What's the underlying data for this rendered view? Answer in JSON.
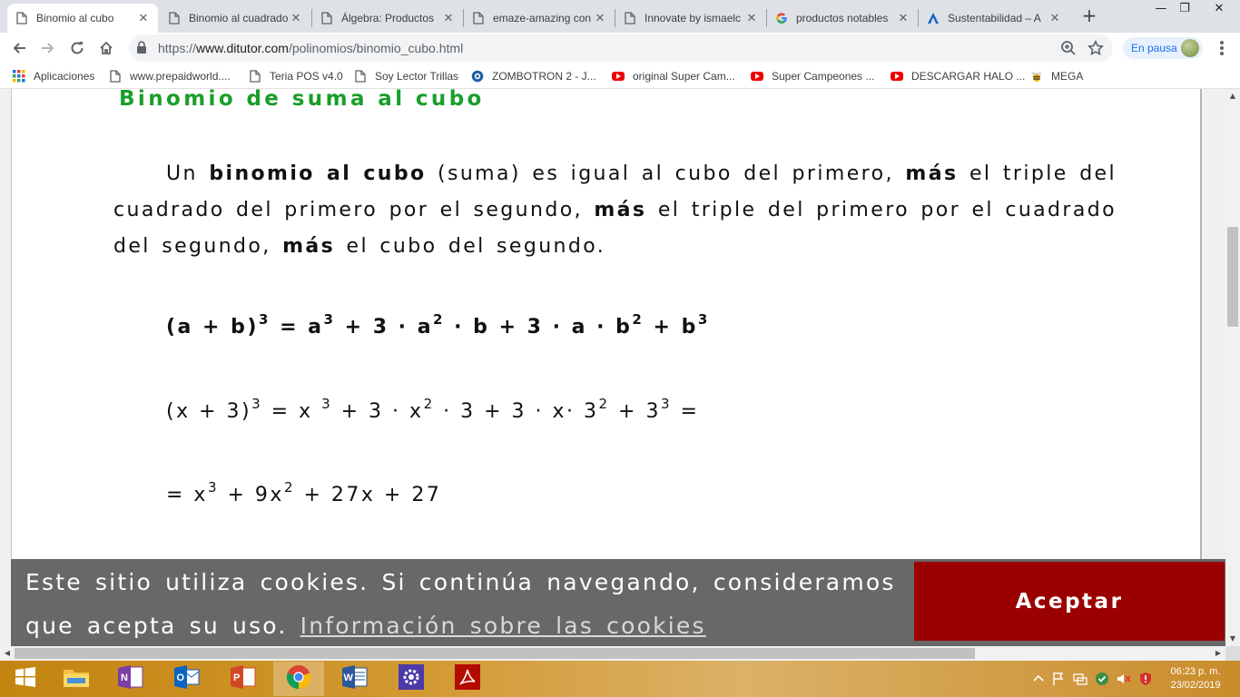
{
  "browser": {
    "tabs": [
      {
        "title": "Binomio al cubo",
        "icon": "page-icon",
        "active": true
      },
      {
        "title": "Binomio al cuadrado",
        "icon": "page-icon",
        "active": false
      },
      {
        "title": "Álgebra: Productos",
        "icon": "page-icon",
        "active": false
      },
      {
        "title": "emaze-amazing con",
        "icon": "page-icon",
        "active": false
      },
      {
        "title": "Innovate by ismaelc",
        "icon": "page-icon",
        "active": false
      },
      {
        "title": "productos notables",
        "icon": "google-icon",
        "active": false
      },
      {
        "title": "Sustentabilidad – A",
        "icon": "a-logo-icon",
        "active": false
      }
    ],
    "new_tab_symbol": "+",
    "url": {
      "prefix": "https://",
      "host": "www.ditutor.com",
      "path": "/polinomios/binomio_cubo.html"
    },
    "profile_label": "En pausa",
    "bookmarks": [
      {
        "label": "Aplicaciones",
        "icon": "apps-grid-icon"
      },
      {
        "label": "www.prepaidworld....",
        "icon": "page-icon"
      },
      {
        "label": "Teria POS v4.0",
        "icon": "page-icon"
      },
      {
        "label": "Soy Lector Trillas",
        "icon": "page-icon"
      },
      {
        "label": "ZOMBOTRON 2 - J...",
        "icon": "globe-icon"
      },
      {
        "label": "original Super Cam...",
        "icon": "youtube-icon"
      },
      {
        "label": "Super Campeones ...",
        "icon": "youtube-icon"
      },
      {
        "label": "DESCARGAR HALO ...",
        "icon": "youtube-icon"
      },
      {
        "label": "MEGA",
        "icon": "bee-icon"
      }
    ]
  },
  "page": {
    "heading": "Binomio de suma al cubo",
    "paragraph": {
      "t1": "Un ",
      "b1": "binomio al cubo",
      "t2": " (suma) es igual al cubo del primero, ",
      "b2": "más",
      "t3": " el triple del cuadrado del primero por el segundo, ",
      "b3": "más",
      "t4": " el triple del primero por el cuadrado del segundo, ",
      "b4": "más",
      "t5": " el cubo del segundo."
    },
    "formula_general": {
      "p1": "(a + b)",
      "e1": "3",
      "p2": " = a",
      "e2": "3",
      "p3": " + 3 · a",
      "e3": "2",
      "p4": " · b + 3 · a · b",
      "e4": "2",
      "p5": " + b",
      "e5": "3"
    },
    "example_line1": {
      "p1": "(x + 3)",
      "e1": "3",
      "p2": " = x ",
      "e2": "3",
      "p3": " + 3 · x",
      "e3": "2",
      "p4": " · 3 + 3 · x· 3",
      "e4": "2",
      "p5": " + 3",
      "e5": "3",
      "p6": " ="
    },
    "example_line2": {
      "p1": "= x",
      "e1": "3",
      "p2": " + 9x",
      "e2": "2",
      "p3": " + 27x + 27"
    },
    "cookie_banner": {
      "message": "Este sitio utiliza cookies. Si continúa navegando, consideramos que acepta su uso.",
      "link": "Información sobre las cookies",
      "accept_label": "Aceptar"
    }
  },
  "taskbar": {
    "apps": [
      "start-icon",
      "file-explorer-icon",
      "onenote-icon",
      "outlook-icon",
      "powerpoint-icon",
      "chrome-icon",
      "word-icon",
      "settings-icon",
      "acrobat-icon"
    ],
    "clock_time": "06:23 p. m.",
    "clock_date": "23/02/2019"
  },
  "colors": {
    "heading_green": "#1a9e2a",
    "cookie_bg": "#686868",
    "accept_red": "#9b0000",
    "tab_strip": "#dee1e6",
    "profile_blue": "#1a73e8"
  }
}
